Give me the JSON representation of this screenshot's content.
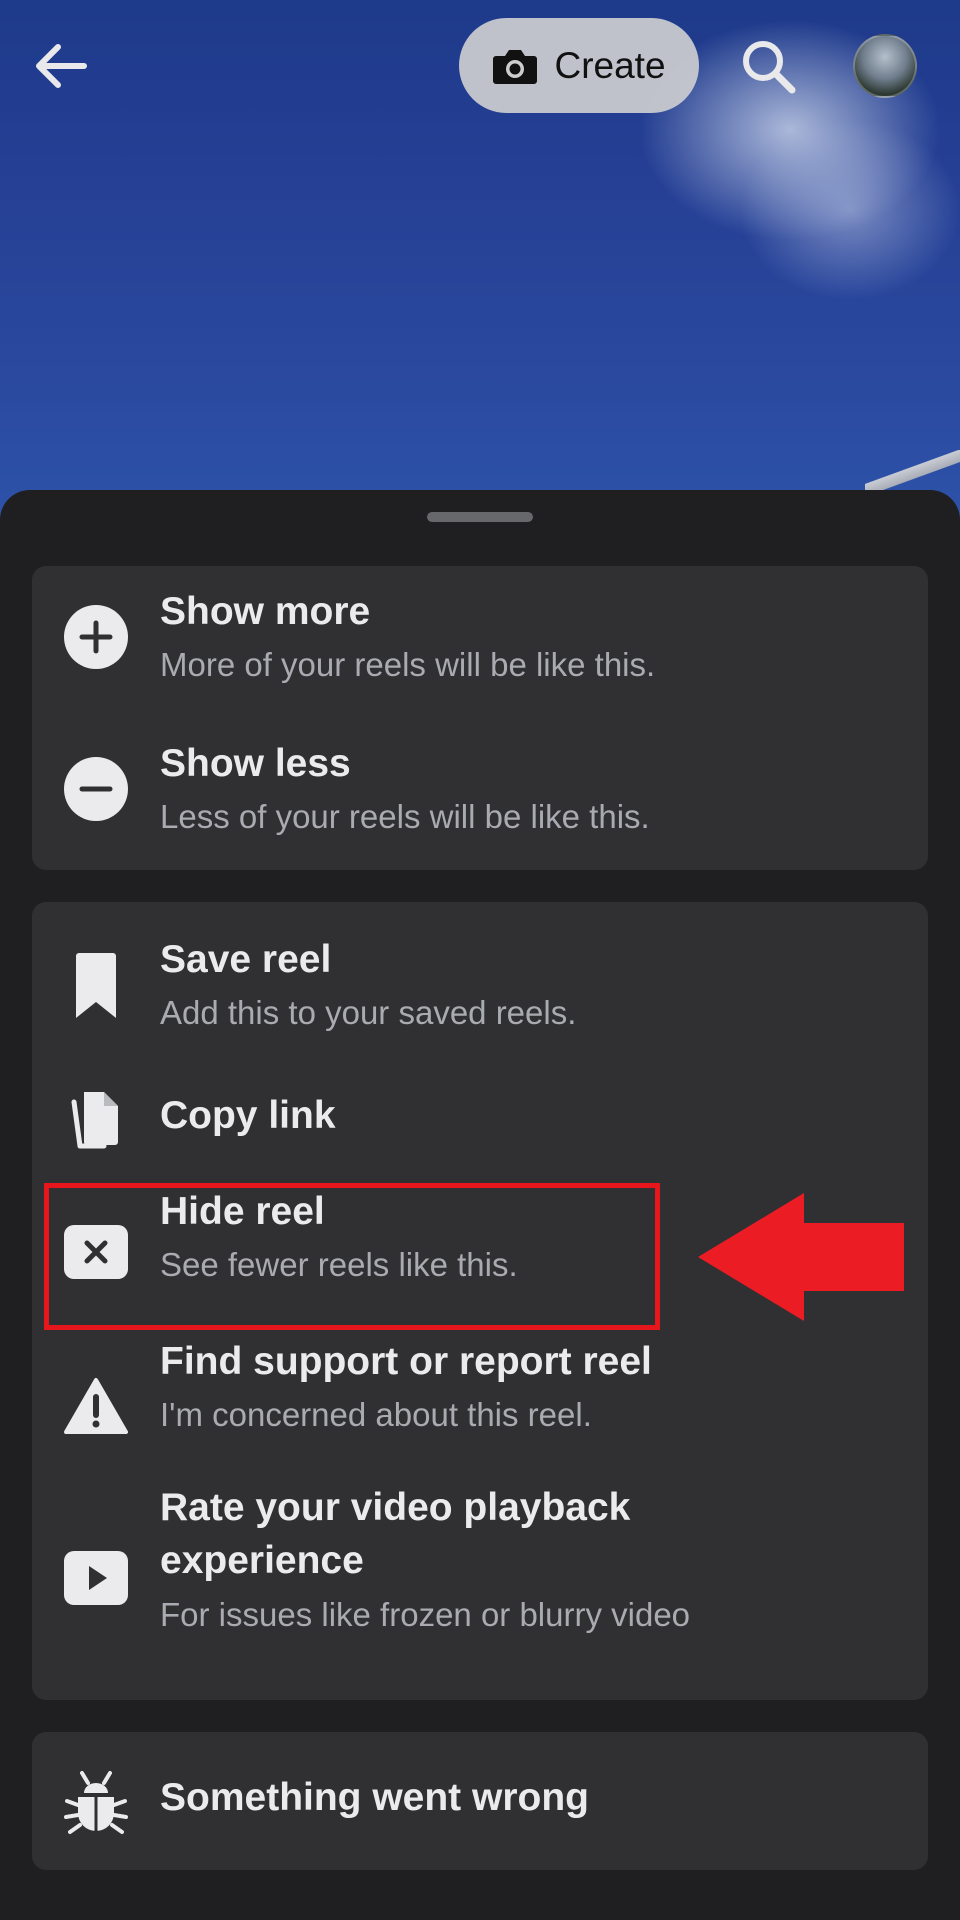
{
  "header": {
    "create_label": "Create",
    "icons": [
      "back-arrow-icon",
      "camera-icon",
      "search-icon",
      "avatar"
    ]
  },
  "menu": {
    "group1": [
      {
        "title": "Show more",
        "subtitle": "More of your reels will be like this.",
        "icon": "plus-circle-icon"
      },
      {
        "title": "Show less",
        "subtitle": "Less of your reels will be like this.",
        "icon": "minus-circle-icon"
      }
    ],
    "group2": [
      {
        "title": "Save reel",
        "subtitle": "Add this to your saved reels.",
        "icon": "bookmark-icon"
      },
      {
        "title": "Copy link",
        "subtitle": "",
        "icon": "copy-icon"
      },
      {
        "title": "Hide reel",
        "subtitle": "See fewer reels like this.",
        "icon": "hide-x-icon"
      },
      {
        "title": "Find support or report reel",
        "subtitle": "I'm concerned about this reel.",
        "icon": "warning-icon"
      },
      {
        "title_line1": "Rate your video playback",
        "title_line2": "experience",
        "subtitle": "For issues like frozen or blurry video",
        "icon": "play-icon"
      }
    ],
    "group3": [
      {
        "title": "Something went wrong",
        "icon": "bug-icon"
      }
    ]
  },
  "annotation": {
    "highlight_color": "#e7151c",
    "arrow_color": "#ec1c24",
    "highlighted_item": "Hide reel"
  },
  "colors": {
    "sheet_bg": "#1f1f21",
    "card_bg": "#303032",
    "title_text": "#ebebed",
    "subtitle_text": "#a9abb0"
  }
}
